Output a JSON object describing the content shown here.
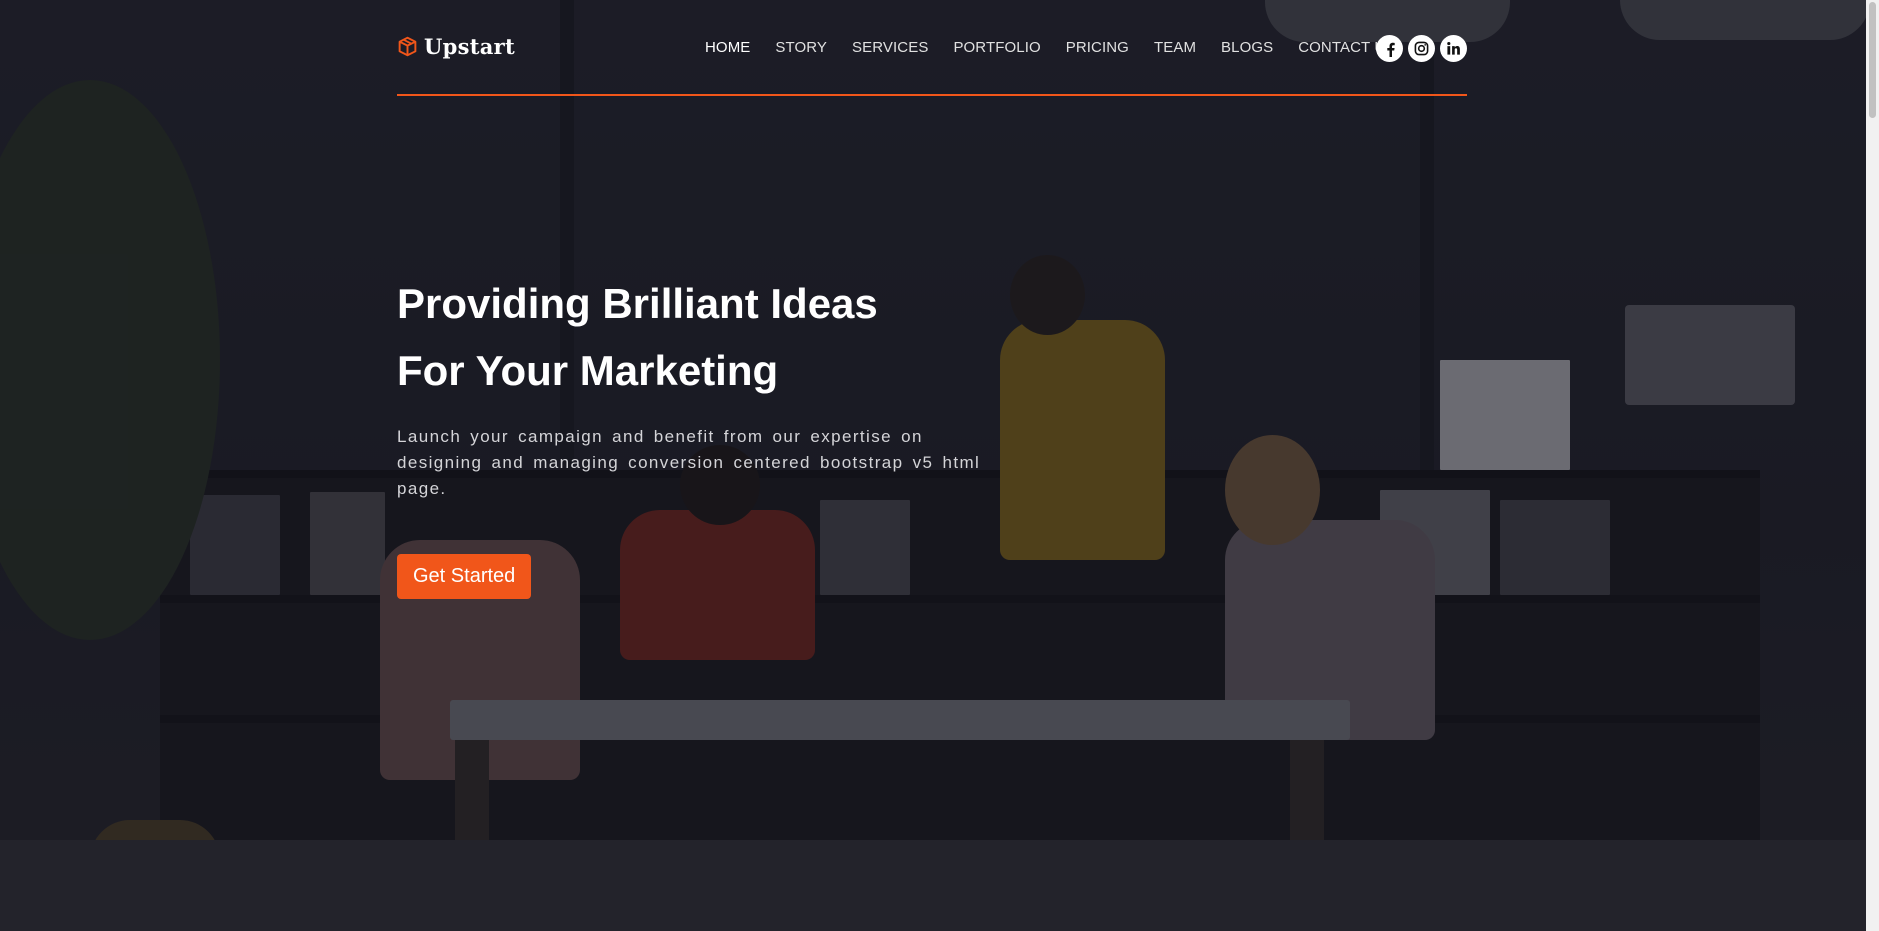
{
  "brand": {
    "name": "Upstart",
    "icon": "cube-icon",
    "accent": "#f1561a"
  },
  "nav": {
    "items": [
      {
        "label": "HOME",
        "active": true
      },
      {
        "label": "STORY"
      },
      {
        "label": "SERVICES"
      },
      {
        "label": "PORTFOLIO"
      },
      {
        "label": "PRICING"
      },
      {
        "label": "TEAM"
      },
      {
        "label": "BLOGS"
      },
      {
        "label": "CONTACT US"
      }
    ]
  },
  "social": [
    {
      "icon": "facebook-icon"
    },
    {
      "icon": "instagram-icon"
    },
    {
      "icon": "linkedin-icon"
    }
  ],
  "hero": {
    "title_line1": "Providing Brilliant Ideas",
    "title_line2": "For Your Marketing",
    "description": "Launch your campaign and benefit from our expertise on designing and managing conversion centered bootstrap v5 html page.",
    "cta_label": "Get Started"
  }
}
